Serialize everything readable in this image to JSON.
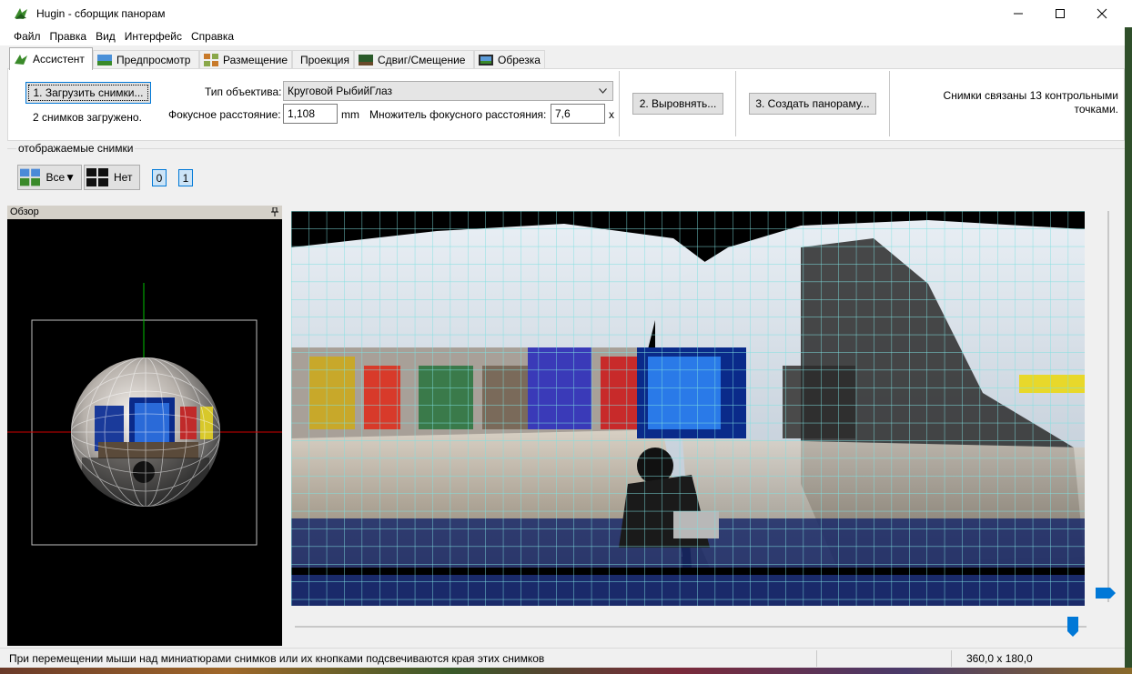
{
  "window": {
    "title": "Hugin - сборщик панорам"
  },
  "menu": [
    "Файл",
    "Правка",
    "Вид",
    "Интерфейс",
    "Справка"
  ],
  "tabs": [
    {
      "label": "Ассистент",
      "icon": "hugin-icon",
      "active": true
    },
    {
      "label": "Предпросмотр",
      "icon": "preview-icon"
    },
    {
      "label": "Размещение",
      "icon": "layout-icon"
    },
    {
      "label": "Проекция",
      "icon": ""
    },
    {
      "label": "Сдвиг/Смещение",
      "icon": "move-icon"
    },
    {
      "label": "Обрезка",
      "icon": "crop-icon"
    }
  ],
  "assistant": {
    "load_button": "1. Загрузить снимки...",
    "loaded_status": "2 снимков загружено.",
    "lens_type_label": "Тип объектива:",
    "lens_type_value": "Круговой РыбийГлаз",
    "focal_length_label": "Фокусное расстояние:",
    "focal_length_value": "1,108",
    "focal_length_unit": "mm",
    "crop_factor_label": "Множитель фокусного расстояния:",
    "crop_factor_value": "7,6",
    "crop_factor_unit": "x",
    "align_button": "2. Выровнять...",
    "create_button": "3. Создать панораму...",
    "cp_info": "Снимки связаны 13 контрольными точками."
  },
  "displayed_images": {
    "caption": "отображаемые снимки",
    "all_button": "Все▼",
    "none_button": "Нет",
    "image_buttons": [
      "0",
      "1"
    ]
  },
  "overview": {
    "title": "Обзор"
  },
  "statusbar": {
    "text": "При перемещении мыши над миниатюрами снимков или их кнопками подсвечиваются края этих снимков",
    "fov": "360,0 x 180,0"
  },
  "sliders": {
    "horizontal_fov": 0.99,
    "vertical_fov": 0.99
  },
  "colors": {
    "accent": "#0078d7",
    "grid": "#7fe0e0",
    "overview_vertical": "#00c000",
    "overview_horizontal": "#d00000"
  }
}
